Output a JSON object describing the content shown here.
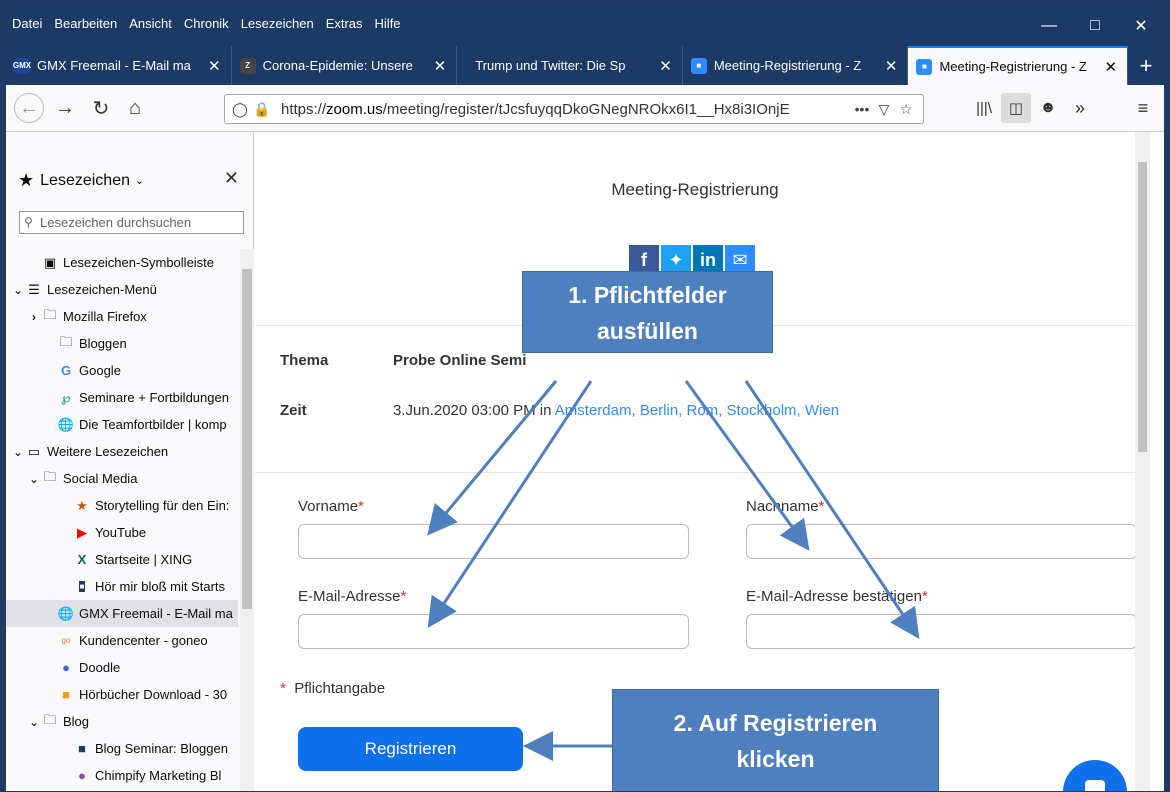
{
  "menu": [
    "Datei",
    "Bearbeiten",
    "Ansicht",
    "Chronik",
    "Lesezeichen",
    "Extras",
    "Hilfe"
  ],
  "tabs": [
    {
      "label": "GMX Freemail - E-Mail ma",
      "fav_text": "GMX",
      "fav_color": "#1c449b"
    },
    {
      "label": "Corona-Epidemie: Unsere",
      "fav_text": "Z",
      "fav_color": "#444"
    },
    {
      "label": "Trump und Twitter: Die Sp",
      "fav_text": "",
      "fav_color": "transparent"
    },
    {
      "label": "Meeting-Registrierung - Z",
      "fav_text": "",
      "fav_color": "#2d8cff"
    },
    {
      "label": "Meeting-Registrierung - Z",
      "fav_text": "",
      "fav_color": "#2d8cff"
    }
  ],
  "url": {
    "prefix": "https://",
    "host": "zoom.us",
    "path": "/meeting/register/tJcsfuyqqDkoGNegNROkx6I1__Hx8i3IOnjE"
  },
  "sidebar": {
    "title": "Lesezeichen",
    "search_placeholder": "Lesezeichen durchsuchen",
    "items": [
      {
        "label": "Lesezeichen-Symbolleiste",
        "indent": 1,
        "icon": "star-box-icon",
        "twisty": ""
      },
      {
        "label": "Lesezeichen-Menü",
        "indent": 0,
        "icon": "menu-list-icon",
        "twisty": "v"
      },
      {
        "label": "Mozilla Firefox",
        "indent": 1,
        "icon": "folder-icon",
        "twisty": ">"
      },
      {
        "label": "Bloggen",
        "indent": 2,
        "icon": "folder-icon",
        "twisty": ""
      },
      {
        "label": "Google",
        "indent": 2,
        "icon": "google-icon",
        "twisty": ""
      },
      {
        "label": "Seminare + Fortbildungen",
        "indent": 2,
        "icon": "seminar-icon",
        "twisty": ""
      },
      {
        "label": "Die Teamfortbilder | komp",
        "indent": 2,
        "icon": "globe-icon",
        "twisty": ""
      },
      {
        "label": "Weitere Lesezeichen",
        "indent": 0,
        "icon": "inbox-icon",
        "twisty": "v"
      },
      {
        "label": "Social Media",
        "indent": 1,
        "icon": "folder-icon",
        "twisty": "v"
      },
      {
        "label": "Storytelling für den Ein:",
        "indent": 3,
        "icon": "storytelling-icon",
        "twisty": ""
      },
      {
        "label": "YouTube",
        "indent": 3,
        "icon": "youtube-icon",
        "twisty": ""
      },
      {
        "label": "Startseite | XING",
        "indent": 3,
        "icon": "xing-icon",
        "twisty": ""
      },
      {
        "label": "Hör mir bloß mit Starts",
        "indent": 3,
        "icon": "podcast-icon",
        "twisty": ""
      },
      {
        "label": "GMX Freemail - E-Mail ma",
        "indent": 2,
        "icon": "globe-icon",
        "twisty": "",
        "selected": true
      },
      {
        "label": "Kundencenter - goneo",
        "indent": 2,
        "icon": "goneo-icon",
        "twisty": ""
      },
      {
        "label": "Doodle",
        "indent": 2,
        "icon": "doodle-icon",
        "twisty": ""
      },
      {
        "label": "Hörbücher Download - 30",
        "indent": 2,
        "icon": "audiobook-icon",
        "twisty": ""
      },
      {
        "label": "Blog",
        "indent": 1,
        "icon": "folder-icon",
        "twisty": "v"
      },
      {
        "label": "Blog Seminar: Bloggen",
        "indent": 3,
        "icon": "blog-seminar-icon",
        "twisty": ""
      },
      {
        "label": "Chimpify Marketing Bl",
        "indent": 3,
        "icon": "chimpify-icon",
        "twisty": ""
      }
    ]
  },
  "page": {
    "title": "Meeting-Registrierung",
    "topic_label": "Thema",
    "topic_value": "Probe Online Semi",
    "time_label": "Zeit",
    "time_value": "3.Jun.2020 03:00 PM in ",
    "time_zone": "Amsterdam, Berlin, Rom, Stockholm, Wien",
    "fields": {
      "firstname": "Vorname",
      "lastname": "Nachname",
      "email": "E-Mail-Adresse",
      "email_confirm": "E-Mail-Adresse bestätigen"
    },
    "required_star": "*",
    "required_note": "Pflichtangabe",
    "register_button": "Registrieren"
  },
  "callouts": {
    "step1_line1": "1. Pflichtfelder",
    "step1_line2": "ausfüllen",
    "step2_line1": "2. Auf Registrieren",
    "step2_line2": "klicken"
  },
  "colors": {
    "titlebar": "#1c3a66",
    "zoom_blue": "#0e71eb",
    "callout": "#4e7fbf",
    "required": "#e02828"
  }
}
